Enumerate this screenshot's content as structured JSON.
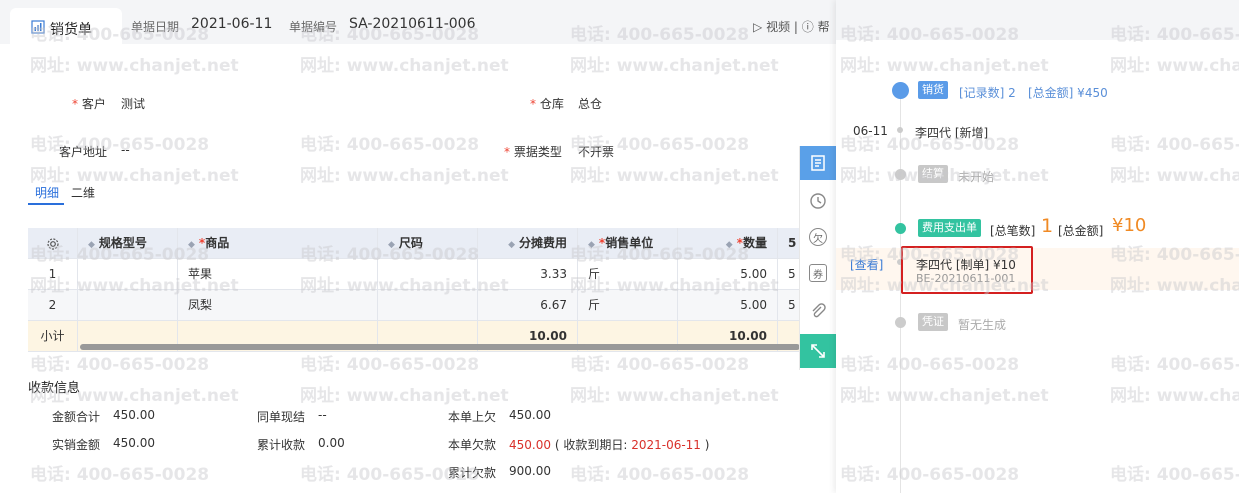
{
  "header": {
    "tab_label": "销货单",
    "date_label": "单据日期",
    "date_value": "2021-06-11",
    "number_label": "单据编号",
    "number_value": "SA-20210611-006",
    "video_label": "视频",
    "help_label": "帮"
  },
  "form": {
    "customer_label": "客户",
    "customer_value": "测试",
    "warehouse_label": "仓库",
    "warehouse_value": "总仓",
    "address_label": "客户地址",
    "address_value": "--",
    "invoice_label": "票据类型",
    "invoice_value": "不开票",
    "required_mark": "*"
  },
  "subtabs": [
    "明细",
    "二维"
  ],
  "table": {
    "columns": [
      "规格型号",
      "商品",
      "尺码",
      "分摊费用",
      "销售单位",
      "数量",
      "5"
    ],
    "rows": [
      {
        "no": "1",
        "spec": "",
        "product": "苹果",
        "size": "",
        "fee": "3.33",
        "unit": "斤",
        "qty": "5.00",
        "extra": "5"
      },
      {
        "no": "2",
        "spec": "",
        "product": "凤梨",
        "size": "",
        "fee": "6.67",
        "unit": "斤",
        "qty": "5.00",
        "extra": "5"
      }
    ],
    "subtotal": {
      "label": "小计",
      "fee": "10.00",
      "qty": "10.00"
    }
  },
  "payment": {
    "title": "收款信息",
    "total_label": "金额合计",
    "total_value": "450.00",
    "cash_label": "同单现结",
    "cash_value": "--",
    "prev_owe_label": "本单上欠",
    "prev_owe_value": "450.00",
    "actual_label": "实销金额",
    "actual_value": "450.00",
    "cum_recv_label": "累计收款",
    "cum_recv_value": "0.00",
    "owe_label": "本单欠款",
    "owe_value": "450.00",
    "due_prefix": "( 收款到期日:",
    "due_date": "2021-06-11",
    "due_suffix": ")",
    "cum_owe_label": "累计欠款",
    "cum_owe_value": "900.00"
  },
  "toolbar": {
    "owe_icon": "欠",
    "coupon_icon": "券"
  },
  "panel": {
    "sales_badge": "销货",
    "sales_records": "[记录数] 2",
    "sales_amount": "[总金额] ¥450",
    "date": "06-11",
    "add_entry": "李四代 [新增]",
    "settle_badge": "结算",
    "settle_status": "未开始",
    "expense_badge": "费用支出单",
    "expense_count_label": "[总笔数]",
    "expense_count": "1",
    "expense_amount_label": "[总金额]",
    "expense_amount": "¥10",
    "view_link": "[查看]",
    "expense_entry": "李四代 [制单] ¥10",
    "expense_code": "BE-20210611-001",
    "voucher_badge": "凭证",
    "voucher_status": "暂无生成"
  },
  "watermark": {
    "phone": "电话: 400-665-0028",
    "site": "网址: www.chanjet.net"
  },
  "colors": {
    "accent": "#2a6fdb",
    "teal": "#33c3a0",
    "orange": "#f08a24",
    "red": "#d42020"
  }
}
